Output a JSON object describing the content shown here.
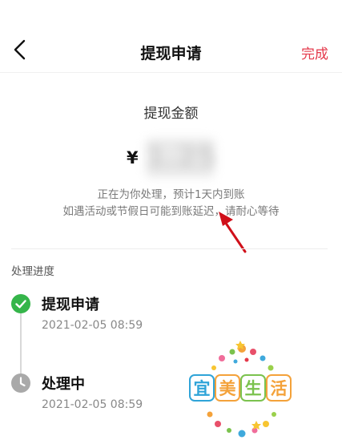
{
  "header": {
    "title": "提现申请",
    "action_label": "完成"
  },
  "amount": {
    "label": "提现金额",
    "currency": "¥",
    "value": "1.25"
  },
  "notice": {
    "line1": "正在为你处理，预计1天内到账",
    "line2": "如遇活动或节假日可能到账延迟，请耐心等待"
  },
  "progress": {
    "section_title": "处理进度",
    "steps": [
      {
        "title": "提现申请",
        "time": "2021-02-05 08:59",
        "status": "done"
      },
      {
        "title": "处理中",
        "time": "2021-02-05 08:59",
        "status": "pending"
      }
    ]
  },
  "watermark": {
    "text": "宜美生活"
  },
  "colors": {
    "accent": "#e4384a",
    "success": "#35b54a",
    "pending": "#a9a9a9",
    "arrow": "#d0101a"
  }
}
